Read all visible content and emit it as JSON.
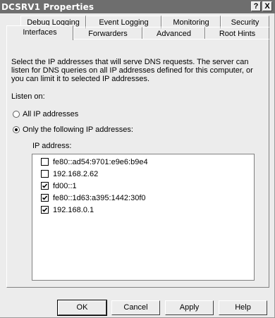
{
  "window": {
    "title": "DCSRV1 Properties",
    "help_glyph": "?",
    "close_glyph": "X"
  },
  "tabs_top": [
    "Debug Logging",
    "Event Logging",
    "Monitoring",
    "Security"
  ],
  "tabs_bottom": [
    "Interfaces",
    "Forwarders",
    "Advanced",
    "Root Hints"
  ],
  "active_tab": "Interfaces",
  "description": "Select the IP addresses that will serve DNS requests. The server can listen for DNS queries on all IP addresses defined for this computer, or you can limit it to selected IP addresses.",
  "listen_on_label": "Listen on:",
  "radio_all": {
    "label": "All IP addresses",
    "selected": false
  },
  "radio_only": {
    "label": "Only the following IP addresses:",
    "selected": true
  },
  "ip_label": "IP address:",
  "ip_list": [
    {
      "address": "fe80::ad54:9701:e9e6:b9e4",
      "checked": false
    },
    {
      "address": "192.168.2.62",
      "checked": false
    },
    {
      "address": "fd00::1",
      "checked": true
    },
    {
      "address": "fe80::1d63:a395:1442:30f0",
      "checked": true
    },
    {
      "address": "192.168.0.1",
      "checked": true
    }
  ],
  "buttons": {
    "ok": "OK",
    "cancel": "Cancel",
    "apply": "Apply",
    "help": "Help"
  }
}
